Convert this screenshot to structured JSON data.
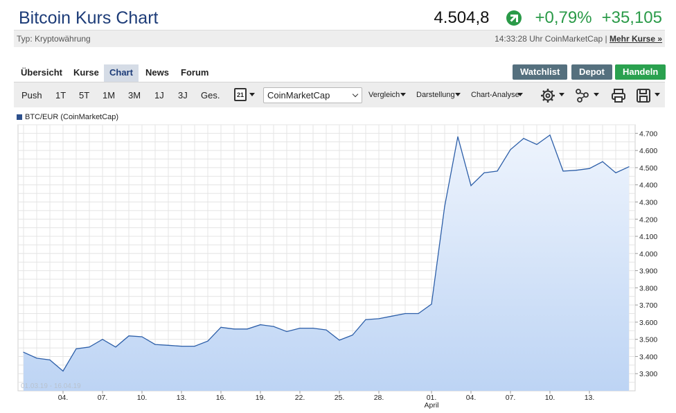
{
  "header": {
    "title": "Bitcoin Kurs Chart",
    "price": "4.504,8",
    "change_pct": "+0,79%",
    "change_abs": "+35,105",
    "type_label": "Typ: Kryptowährung",
    "timestamp_source": "14:33:28 Uhr CoinMarketCap |",
    "more_link": "Mehr Kurse »"
  },
  "tabs": [
    "Übersicht",
    "Kurse",
    "Chart",
    "News",
    "Forum"
  ],
  "active_tab": "Chart",
  "action_buttons": [
    "Watchlist",
    "Depot",
    "Handeln"
  ],
  "toolbar": {
    "ranges": [
      "Push",
      "1T",
      "5T",
      "1M",
      "3M",
      "1J",
      "3J",
      "Ges."
    ],
    "calendar_day": "21",
    "exchange": "CoinMarketCap",
    "menus": [
      "Vergleich",
      "Darstellung",
      "Chart-Analyse"
    ],
    "icons": [
      "calendar-icon",
      "gear-icon",
      "indicator-icon",
      "print-icon",
      "save-icon"
    ]
  },
  "colors": {
    "line": "#2c5ea8",
    "fill_top": "#eef4fd",
    "fill_bottom": "#bdd4f4",
    "green": "#2a9a48",
    "title": "#1d3c78"
  },
  "chart_data": {
    "type": "area",
    "series": [
      {
        "name": "BTC/EUR (CoinMarketCap)",
        "x": [
          "2019-03-01",
          "2019-03-02",
          "2019-03-03",
          "2019-03-04",
          "2019-03-05",
          "2019-03-06",
          "2019-03-07",
          "2019-03-08",
          "2019-03-09",
          "2019-03-10",
          "2019-03-11",
          "2019-03-12",
          "2019-03-13",
          "2019-03-14",
          "2019-03-15",
          "2019-03-16",
          "2019-03-17",
          "2019-03-18",
          "2019-03-19",
          "2019-03-20",
          "2019-03-21",
          "2019-03-22",
          "2019-03-23",
          "2019-03-24",
          "2019-03-25",
          "2019-03-26",
          "2019-03-27",
          "2019-03-28",
          "2019-03-29",
          "2019-03-30",
          "2019-03-31",
          "2019-04-01",
          "2019-04-02",
          "2019-04-03",
          "2019-04-04",
          "2019-04-05",
          "2019-04-06",
          "2019-04-07",
          "2019-04-08",
          "2019-04-09",
          "2019-04-10",
          "2019-04-11",
          "2019-04-12",
          "2019-04-13",
          "2019-04-14",
          "2019-04-15",
          "2019-04-16"
        ],
        "values": [
          3425,
          3390,
          3380,
          3315,
          3445,
          3455,
          3500,
          3455,
          3520,
          3515,
          3470,
          3465,
          3460,
          3460,
          3490,
          3570,
          3560,
          3560,
          3585,
          3575,
          3545,
          3565,
          3565,
          3555,
          3495,
          3525,
          3615,
          3620,
          3635,
          3650,
          3650,
          3705,
          4275,
          4680,
          4395,
          4470,
          4480,
          4605,
          4670,
          4635,
          4690,
          4480,
          4485,
          4495,
          4535,
          4470,
          4505
        ]
      }
    ],
    "x_ticks": [
      "04.",
      "07.",
      "10.",
      "13.",
      "16.",
      "19.",
      "22.",
      "25.",
      "28.",
      "01.",
      "04.",
      "07.",
      "10.",
      "13."
    ],
    "x_tick_dates": [
      "2019-03-04",
      "2019-03-07",
      "2019-03-10",
      "2019-03-13",
      "2019-03-16",
      "2019-03-19",
      "2019-03-22",
      "2019-03-25",
      "2019-03-28",
      "2019-04-01",
      "2019-04-04",
      "2019-04-07",
      "2019-04-10",
      "2019-04-13"
    ],
    "month_label": "April",
    "month_label_date": "2019-04-01",
    "y_ticks": [
      "3.300",
      "3.400",
      "3.500",
      "3.600",
      "3.700",
      "3.800",
      "3.900",
      "4.000",
      "4.100",
      "4.200",
      "4.300",
      "4.400",
      "4.500",
      "4.600",
      "4.700"
    ],
    "y_tick_values": [
      3300,
      3400,
      3500,
      3600,
      3700,
      3800,
      3900,
      4000,
      4100,
      4200,
      4300,
      4400,
      4500,
      4600,
      4700
    ],
    "ylim": [
      3200,
      4750
    ],
    "date_range_label": "01.03.19 - 16.04.19",
    "grid": true,
    "legend_position": "top-left"
  }
}
